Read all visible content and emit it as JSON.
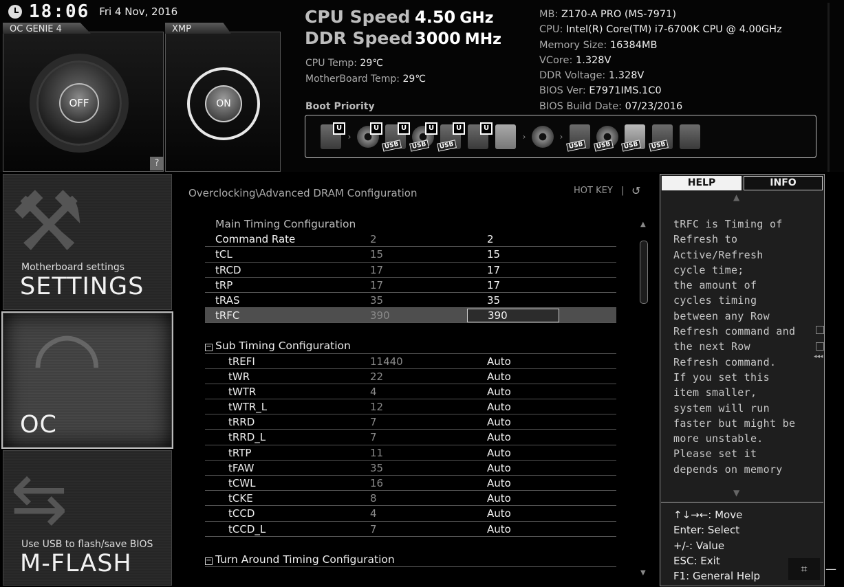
{
  "header": {
    "time": "18:06",
    "date": "Fri  4 Nov, 2016",
    "oc_genie_label": "OC GENIE 4",
    "oc_genie_state": "OFF",
    "xmp_label": "XMP",
    "xmp_state": "ON",
    "help_button": "?",
    "cpu_speed_label": "CPU Speed",
    "cpu_speed_value": "4.50",
    "cpu_speed_unit": "GHz",
    "ddr_speed_label": "DDR Speed",
    "ddr_speed_value": "3000",
    "ddr_speed_unit": "MHz",
    "cpu_temp_label": "CPU Temp:",
    "cpu_temp_value": "29℃",
    "mb_temp_label": "MotherBoard Temp:",
    "mb_temp_value": "29℃",
    "boot_priority_label": "Boot Priority",
    "sysinfo": [
      {
        "label": "MB:",
        "value": "Z170-A PRO (MS-7971)"
      },
      {
        "label": "CPU:",
        "value": "Intel(R) Core(TM) i7-6700K CPU @ 4.00GHz"
      },
      {
        "label": "Memory Size:",
        "value": "16384MB"
      },
      {
        "label": "VCore:",
        "value": "1.328V"
      },
      {
        "label": "DDR Voltage:",
        "value": "1.328V"
      },
      {
        "label": "BIOS Ver:",
        "value": "E7971IMS.1C0"
      },
      {
        "label": "BIOS Build Date:",
        "value": "07/23/2016"
      }
    ],
    "boot_badges": {
      "u": "U",
      "usb": "USB"
    }
  },
  "nav": {
    "settings_sub": "Motherboard settings",
    "settings_title": "SETTINGS",
    "oc_title": "OC",
    "mflash_sub": "Use USB to flash/save BIOS",
    "mflash_title": "M-FLASH"
  },
  "main": {
    "breadcrumb": "Overclocking\\Advanced DRAM Configuration",
    "hotkey": "HOT KEY",
    "hotkey_sep": "|",
    "back_icon": "↺",
    "main_timing_title": "Main Timing Configuration",
    "main_rows": [
      {
        "name": "Command Rate",
        "default": "2",
        "current": "2"
      },
      {
        "name": "tCL",
        "default": "15",
        "current": "15"
      },
      {
        "name": "tRCD",
        "default": "17",
        "current": "17"
      },
      {
        "name": "tRP",
        "default": "17",
        "current": "17"
      },
      {
        "name": "tRAS",
        "default": "35",
        "current": "35"
      },
      {
        "name": "tRFC",
        "default": "390",
        "current": "390"
      }
    ],
    "sub_timing_title": "Sub Timing Configuration",
    "sub_rows": [
      {
        "name": "tREFI",
        "default": "11440",
        "current": "Auto"
      },
      {
        "name": "tWR",
        "default": "22",
        "current": "Auto"
      },
      {
        "name": "tWTR",
        "default": "4",
        "current": "Auto"
      },
      {
        "name": "tWTR_L",
        "default": "12",
        "current": "Auto"
      },
      {
        "name": "tRRD",
        "default": "7",
        "current": "Auto"
      },
      {
        "name": "tRRD_L",
        "default": "7",
        "current": "Auto"
      },
      {
        "name": "tRTP",
        "default": "11",
        "current": "Auto"
      },
      {
        "name": "tFAW",
        "default": "35",
        "current": "Auto"
      },
      {
        "name": "tCWL",
        "default": "16",
        "current": "Auto"
      },
      {
        "name": "tCKE",
        "default": "8",
        "current": "Auto"
      },
      {
        "name": "tCCD",
        "default": "4",
        "current": "Auto"
      },
      {
        "name": "tCCD_L",
        "default": "7",
        "current": "Auto"
      }
    ],
    "turn_around_title": "Turn Around Timing Configuration",
    "collapse_glyph": "−"
  },
  "help": {
    "tab_help": "HELP",
    "tab_info": "INFO",
    "text_lines": [
      "tRFC is Timing of",
      "Refresh to",
      "Active/Refresh",
      "cycle time;",
      "the amount of",
      "cycles timing",
      "between any Row",
      "Refresh command and",
      "the next Row",
      "Refresh command.",
      "If you set this",
      "item smaller,",
      "system will run",
      "faster but might be",
      "more unstable.",
      "Please set it",
      "depends on memory"
    ],
    "keys": [
      "↑↓→←: Move",
      "Enter: Select",
      "+/-: Value",
      "ESC: Exit",
      "F1: General Help"
    ]
  },
  "icons": {
    "clock": "clock-icon",
    "screenshot": "screenshot-icon",
    "screenshot_glyph": "⌗",
    "minimize_glyph": "—",
    "side_arrows": "◂◂◂"
  }
}
